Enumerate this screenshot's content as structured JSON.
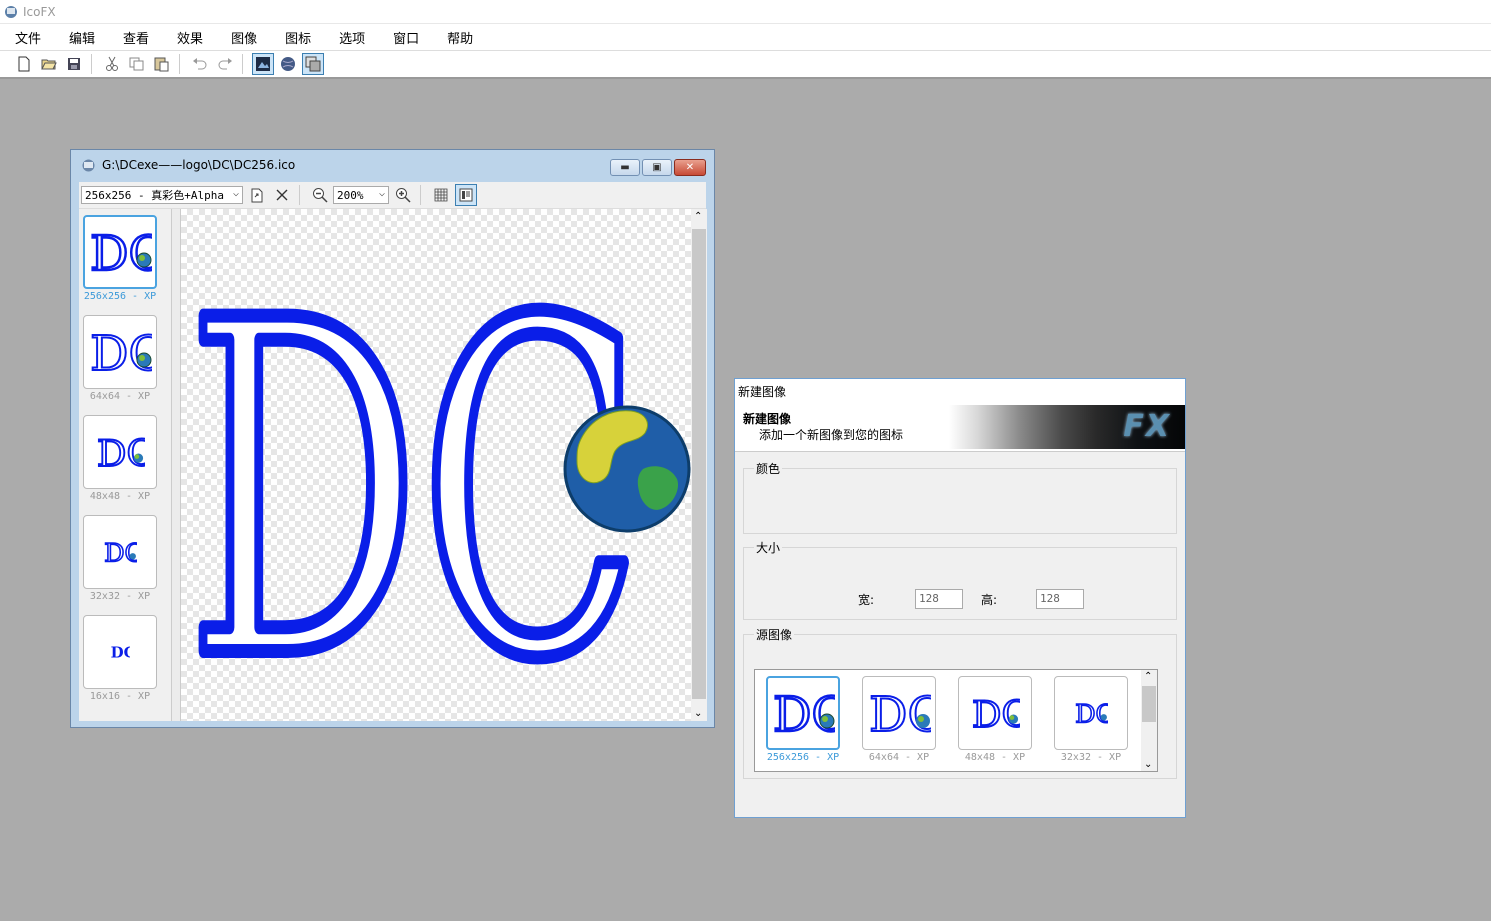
{
  "app": {
    "title": "IcoFX"
  },
  "menu": [
    "文件",
    "编辑",
    "查看",
    "效果",
    "图像",
    "图标",
    "选项",
    "窗口",
    "帮助"
  ],
  "toolbar": {
    "icons": [
      "new-file-icon",
      "open-folder-icon",
      "save-icon",
      "cut-icon",
      "copy-icon",
      "paste-icon",
      "undo-icon",
      "redo-icon",
      "image-editor-icon",
      "web-icon",
      "layers-icon"
    ]
  },
  "document": {
    "title": "G:\\DCexe——logo\\DC\\DC256.ico",
    "format_select": "256x256 - 真彩色+Alpha",
    "zoom_select": "200%",
    "thumbnails": [
      {
        "label": "256x256 - XP",
        "selected": true
      },
      {
        "label": "64x64 - XP",
        "selected": false
      },
      {
        "label": "48x48 - XP",
        "selected": false
      },
      {
        "label": "32x32 - XP",
        "selected": false
      },
      {
        "label": "16x16 - XP",
        "selected": false
      }
    ],
    "logo_text": "DC"
  },
  "dialog": {
    "title": "新建图像",
    "header_title": "新建图像",
    "header_subtitle": "添加一个新图像到您的图标",
    "banner_text": "FX",
    "color_group": "颜色",
    "size_group": "大小",
    "width_label": "宽:",
    "width_value": "128",
    "height_label": "高:",
    "height_value": "128",
    "source_group": "源图像",
    "sources": [
      {
        "label": "256x256 - XP",
        "selected": true
      },
      {
        "label": "64x64 - XP",
        "selected": false
      },
      {
        "label": "48x48 - XP",
        "selected": false
      },
      {
        "label": "32x32 - XP",
        "selected": false
      }
    ]
  },
  "colors": {
    "accent": "#4aa3e0",
    "logo_blue": "#0a1ee8",
    "background": "#ababab"
  }
}
